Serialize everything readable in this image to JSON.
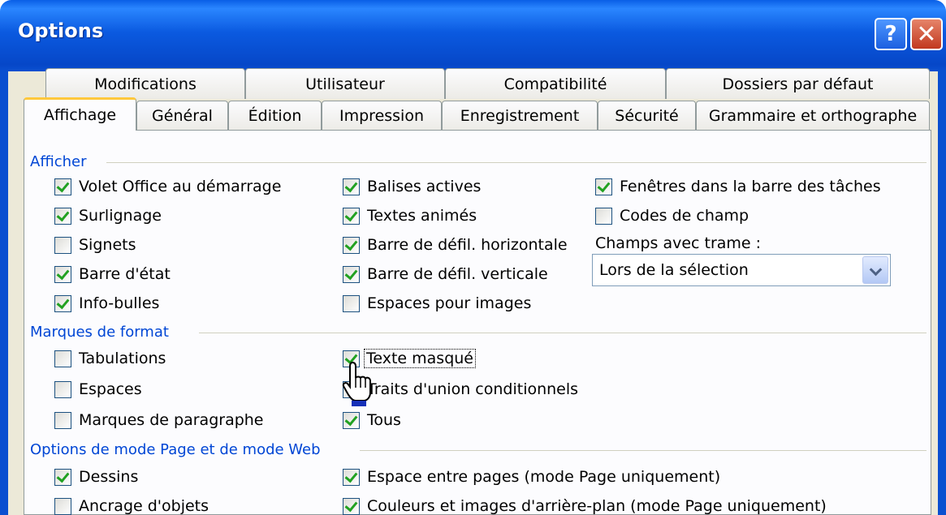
{
  "window": {
    "title": "Options",
    "help_label": "?",
    "close_label": "✕"
  },
  "tabs": {
    "row1": [
      "Modifications",
      "Utilisateur",
      "Compatibilité",
      "Dossiers par défaut"
    ],
    "row2": [
      "Affichage",
      "Général",
      "Édition",
      "Impression",
      "Enregistrement",
      "Sécurité",
      "Grammaire et orthographe"
    ],
    "active": "Affichage"
  },
  "sections": {
    "afficher": "Afficher",
    "marques": "Marques de format",
    "options_mode": "Options de mode Page et de mode Web"
  },
  "afficher": {
    "volet_office": {
      "label": "Volet Office au démarrage",
      "checked": true
    },
    "surlignage": {
      "label": "Surlignage",
      "checked": true
    },
    "signets": {
      "label": "Signets",
      "checked": false
    },
    "barre_etat": {
      "label": "Barre d'état",
      "checked": true
    },
    "info_bulles": {
      "label": "Info-bulles",
      "checked": true
    },
    "balises_actives": {
      "label": "Balises actives",
      "checked": true
    },
    "textes_animes": {
      "label": "Textes animés",
      "checked": true
    },
    "defil_horizontale": {
      "label": "Barre de défil. horizontale",
      "checked": true
    },
    "defil_verticale": {
      "label": "Barre de défil. verticale",
      "checked": true
    },
    "espaces_images": {
      "label": "Espaces pour images",
      "checked": false
    },
    "fenetres_barre": {
      "label": "Fenêtres dans la barre des tâches",
      "checked": true
    },
    "codes_champ": {
      "label": "Codes de champ",
      "checked": false
    },
    "champs_trame_label": "Champs avec trame :",
    "champs_trame_value": "Lors de la sélection"
  },
  "marques": {
    "tabulations": {
      "label": "Tabulations",
      "checked": false
    },
    "espaces": {
      "label": "Espaces",
      "checked": false
    },
    "marques_paragraphe": {
      "label": "Marques de paragraphe",
      "checked": false
    },
    "texte_masque": {
      "label": "Texte masqué",
      "checked": true
    },
    "traits_union": {
      "label": "Traits d'union conditionnels",
      "checked": false
    },
    "tous": {
      "label": "Tous",
      "checked": true
    }
  },
  "options_mode": {
    "dessins": {
      "label": "Dessins",
      "checked": true
    },
    "ancrage": {
      "label": "Ancrage d'objets",
      "checked": false
    },
    "espace_pages": {
      "label": "Espace entre pages (mode Page uniquement)",
      "checked": true
    },
    "couleurs_images": {
      "label": "Couleurs et images d'arrière-plan (mode Page uniquement)",
      "checked": true
    }
  },
  "colors": {
    "titlebar": "#0b5ae0",
    "section_text": "#0046d5",
    "check": "#21a121",
    "active_tab_accent": "#ffc83c"
  }
}
